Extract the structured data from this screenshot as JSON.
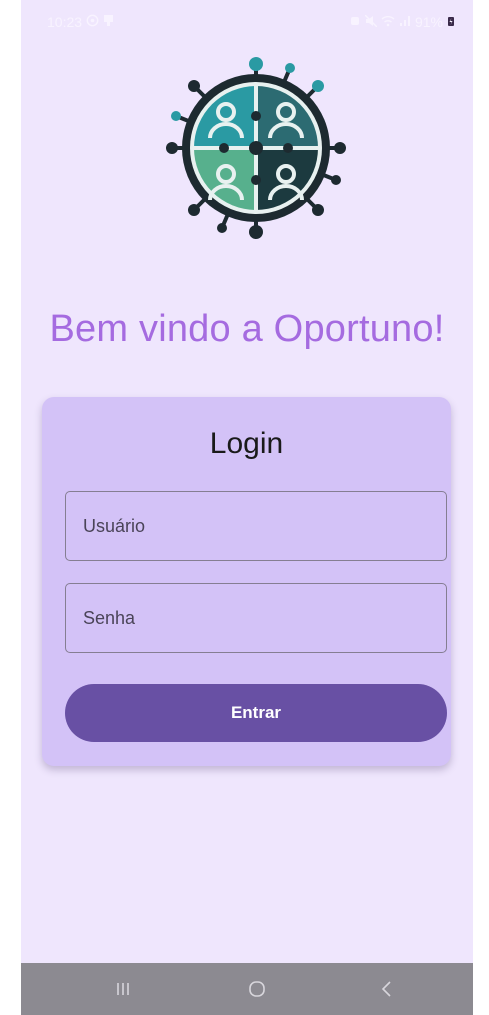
{
  "status_bar": {
    "time": "10:23",
    "battery": "91%"
  },
  "welcome_text": "Bem vindo a Oportuno!",
  "login_card": {
    "title": "Login",
    "username_placeholder": "Usuário",
    "password_placeholder": "Senha",
    "submit_label": "Entrar"
  },
  "colors": {
    "background": "#efe6fd",
    "accent_text": "#a56be0",
    "card": "#d3c2f7",
    "button": "#6850a4",
    "nav_bar": "#8c8a91"
  },
  "icons": {
    "status_left": [
      "whatsapp-icon",
      "notification-icon"
    ],
    "status_right": [
      "bug-icon",
      "mute-icon",
      "wifi-icon",
      "signal-icon",
      "battery-icon"
    ],
    "nav": [
      "recent-apps-icon",
      "home-icon",
      "back-icon"
    ]
  }
}
